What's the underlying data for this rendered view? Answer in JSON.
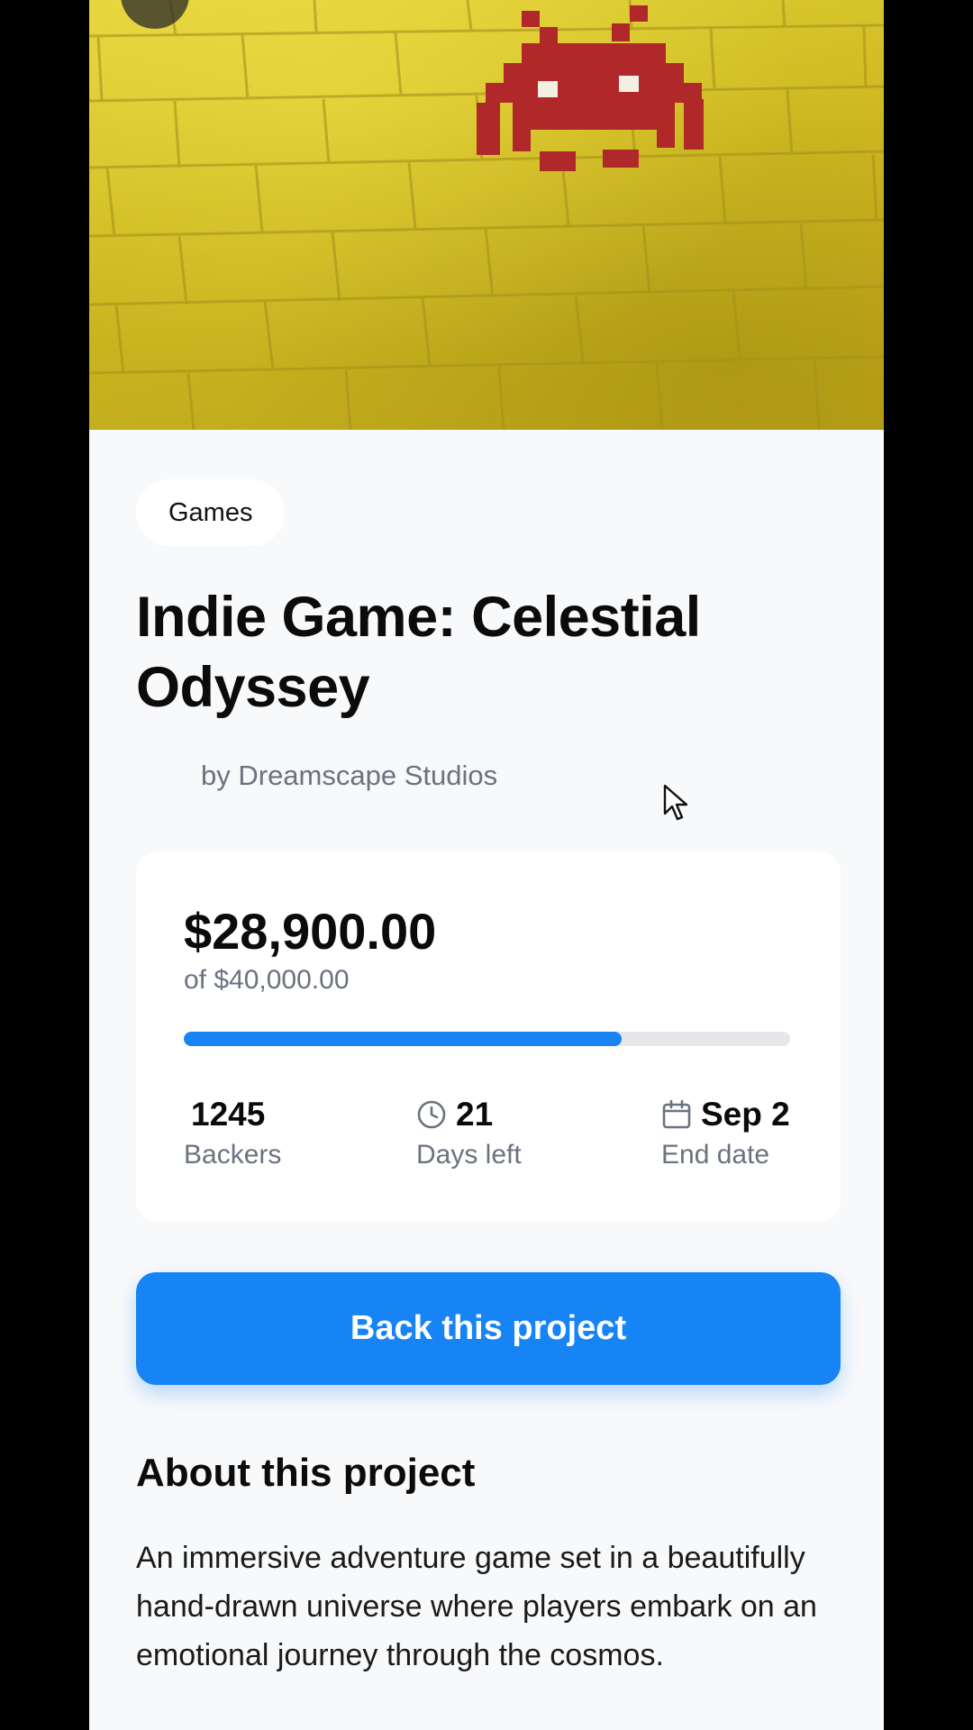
{
  "hero": {
    "image_description_icon": "space-invader-mosaic",
    "colors": {
      "wall": "#d4c126",
      "invader": "#b0282a"
    }
  },
  "project": {
    "category": "Games",
    "title": "Indie Game: Celestial Odyssey",
    "creator": "by Dreamscape Studios"
  },
  "funding": {
    "raised": "$28,900.00",
    "goal": "of $40,000.00",
    "progress_fraction": 0.7225,
    "accent_color": "#1684f4"
  },
  "stats": {
    "backers": {
      "value": "1245",
      "label": "Backers"
    },
    "days_left": {
      "value": "21",
      "label": "Days left",
      "icon": "clock-icon"
    },
    "end_date": {
      "value": "Sep 2",
      "label": "End date",
      "icon": "calendar-icon"
    }
  },
  "cta": {
    "label": "Back this project"
  },
  "about": {
    "heading": "About this project",
    "body": "An immersive adventure game set in a beautifully hand-drawn universe where players embark on an emotional journey through the cosmos."
  }
}
